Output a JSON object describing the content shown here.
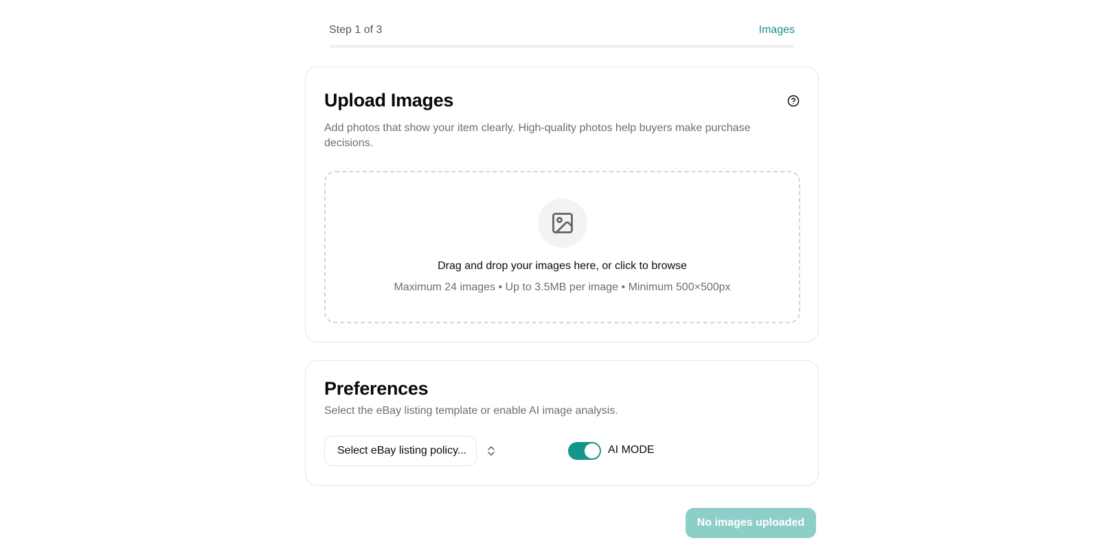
{
  "stepper": {
    "step_label": "Step 1 of 3",
    "step_name": "Images",
    "progress_fraction": 0.0
  },
  "upload_card": {
    "title": "Upload Images",
    "description": "Add photos that show your item clearly. High-quality photos help buyers make purchase decisions.",
    "help_icon": "help-circle-icon",
    "dropzone": {
      "icon": "image-icon",
      "title": "Drag and drop your images here, or click to browse",
      "hint": "Maximum 24 images • Up to 3.5MB per image • Minimum 500×500px"
    }
  },
  "preferences_card": {
    "title": "Preferences",
    "description": "Select the eBay listing template or enable AI image analysis.",
    "policy_select": {
      "value": "Select eBay listing policy...",
      "icon": "chevron-up-down-icon"
    },
    "ai_toggle": {
      "label": "AI MODE",
      "checked": true
    }
  },
  "submit": {
    "label": "No images uploaded",
    "disabled": true
  },
  "colors": {
    "accent": "#14948a",
    "accent_disabled": "#8dcfc8",
    "muted_text": "#6b6e75",
    "border": "#e4e4e7"
  }
}
